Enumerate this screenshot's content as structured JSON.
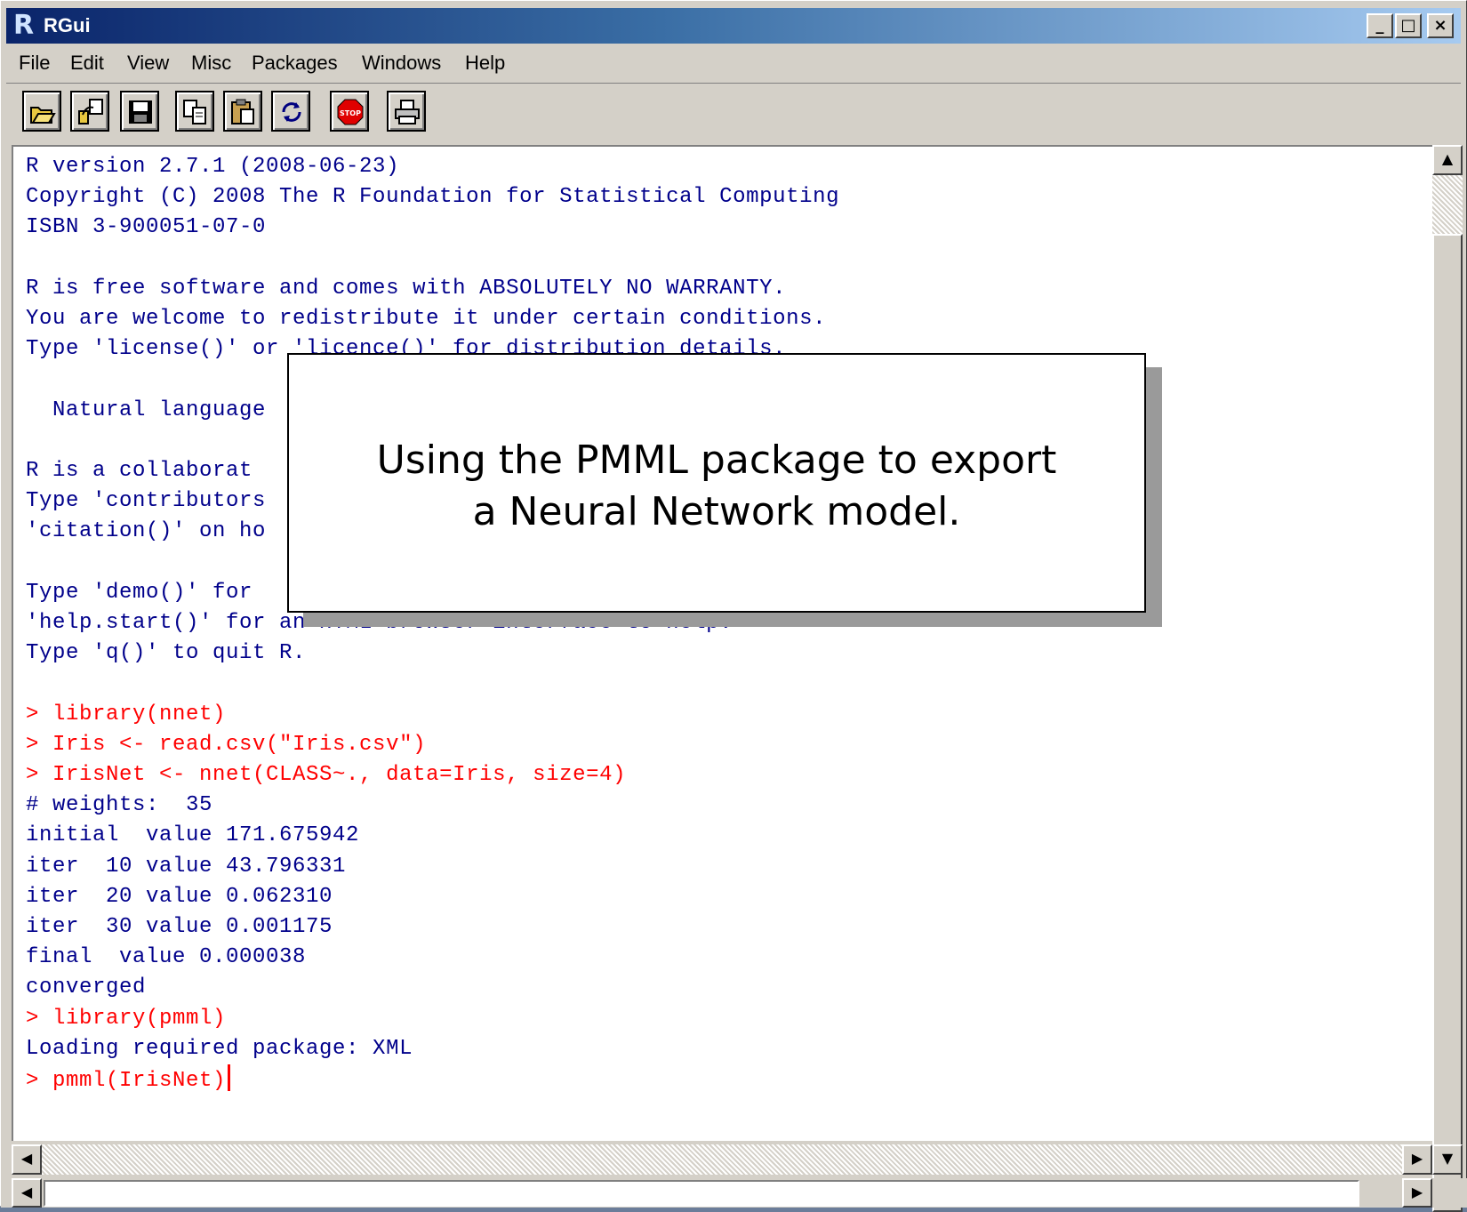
{
  "window": {
    "title": "RGui",
    "controls": [
      "_",
      "□",
      "×"
    ]
  },
  "menu": [
    "File",
    "Edit",
    "View",
    "Misc",
    "Packages",
    "Windows",
    "Help"
  ],
  "toolbar": [
    {
      "icon": "open-script-icon"
    },
    {
      "icon": "load-workspace-icon"
    },
    {
      "icon": "save-icon"
    },
    {
      "icon": "copy-icon"
    },
    {
      "icon": "paste-icon"
    },
    {
      "icon": "refresh-icon"
    },
    {
      "icon": "stop-icon",
      "label": "STOP"
    },
    {
      "icon": "print-icon"
    }
  ],
  "console": {
    "lines": [
      {
        "t": "R version 2.7.1 (2008-06-23)",
        "kind": "out"
      },
      {
        "t": "Copyright (C) 2008 The R Foundation for Statistical Computing",
        "kind": "out"
      },
      {
        "t": "ISBN 3-900051-07-0",
        "kind": "out"
      },
      {
        "t": "",
        "kind": "out"
      },
      {
        "t": "R is free software and comes with ABSOLUTELY NO WARRANTY.",
        "kind": "out"
      },
      {
        "t": "You are welcome to redistribute it under certain conditions.",
        "kind": "out"
      },
      {
        "t": "Type 'license()' or 'licence()' for distribution details.",
        "kind": "out"
      },
      {
        "t": "",
        "kind": "out"
      },
      {
        "t": "  Natural language",
        "kind": "out"
      },
      {
        "t": "",
        "kind": "out"
      },
      {
        "t": "R is a collaborat",
        "kind": "out"
      },
      {
        "t": "Type 'contributors",
        "kind": "out"
      },
      {
        "t": "'citation()' on ho",
        "kind": "out"
      },
      {
        "t": "",
        "kind": "out"
      },
      {
        "t": "Type 'demo()' for",
        "kind": "out"
      },
      {
        "t": "'help.start()' for an HTML browser interface to help.",
        "kind": "out"
      },
      {
        "t": "Type 'q()' to quit R.",
        "kind": "out"
      },
      {
        "t": "",
        "kind": "out"
      },
      {
        "t": "> library(nnet)",
        "kind": "cmd"
      },
      {
        "t": "> Iris <- read.csv(\"Iris.csv\")",
        "kind": "cmd"
      },
      {
        "t": "> IrisNet <- nnet(CLASS~., data=Iris, size=4)",
        "kind": "cmd"
      },
      {
        "t": "# weights:  35",
        "kind": "out"
      },
      {
        "t": "initial  value 171.675942",
        "kind": "out"
      },
      {
        "t": "iter  10 value 43.796331",
        "kind": "out"
      },
      {
        "t": "iter  20 value 0.062310",
        "kind": "out"
      },
      {
        "t": "iter  30 value 0.001175",
        "kind": "out"
      },
      {
        "t": "final  value 0.000038",
        "kind": "out"
      },
      {
        "t": "converged",
        "kind": "out"
      },
      {
        "t": "> library(pmml)",
        "kind": "cmd"
      },
      {
        "t": "Loading required package: XML",
        "kind": "out"
      },
      {
        "t": "> pmml(IrisNet)",
        "kind": "cmd"
      }
    ]
  },
  "callout": {
    "line1": "Using the PMML package to export",
    "line2": "a Neural Network model."
  },
  "colors": {
    "output": "#00008b",
    "command": "#ff0000",
    "titlebar": "#0a246a"
  }
}
